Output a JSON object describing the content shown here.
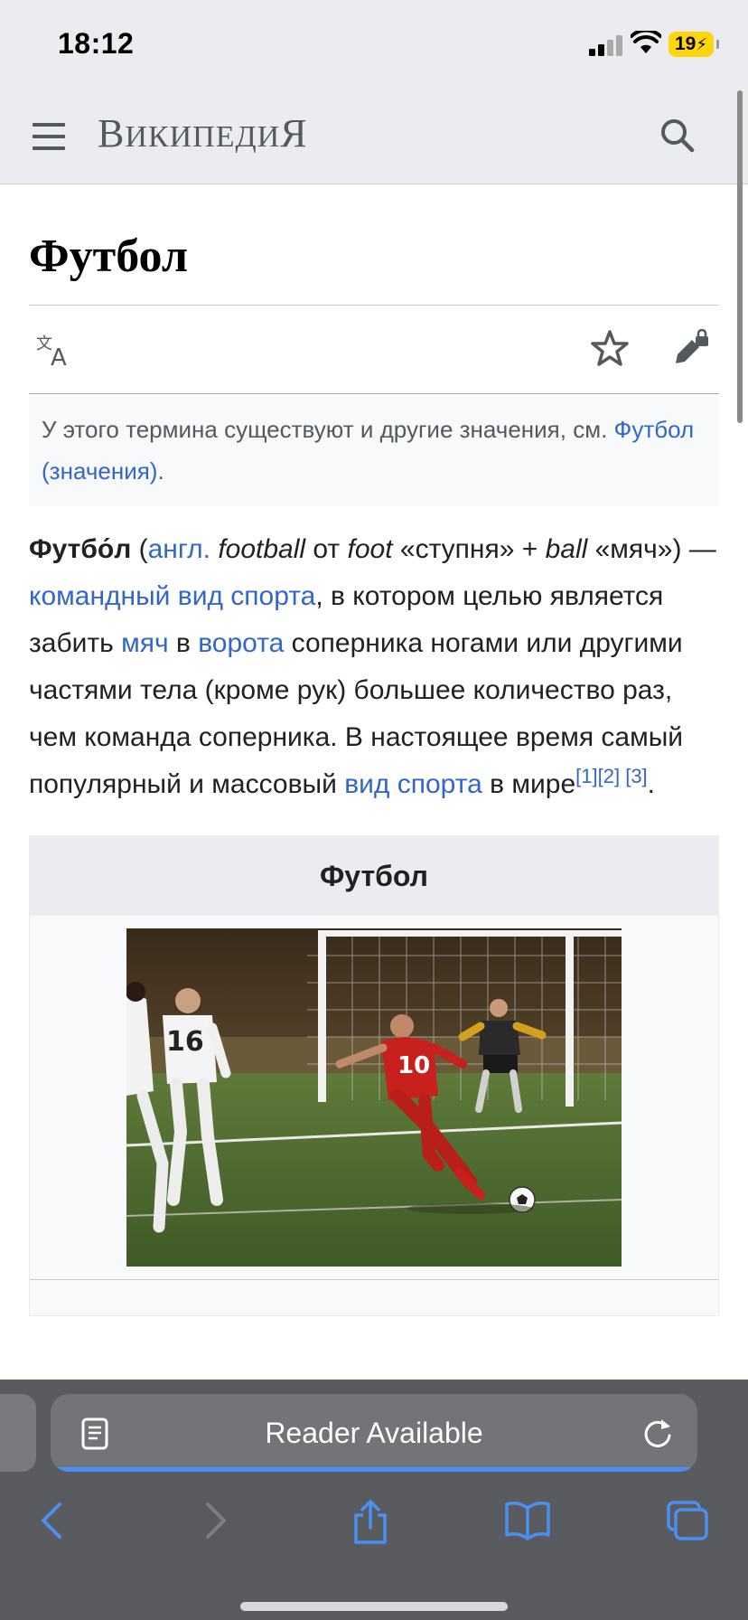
{
  "status": {
    "time": "18:12",
    "battery": "19"
  },
  "header": {
    "wordmark_first": "В",
    "wordmark_small": "ИКИПЕДИ",
    "wordmark_last": "Я"
  },
  "article": {
    "title": "Футбол",
    "hatnote_text": "У этого термина существуют и другие значения, см.",
    "hatnote_link": "Футбол (значения)",
    "hatnote_end": ".",
    "lead": {
      "term": "Футбо́л",
      "p1": " (",
      "engl": "англ.",
      "football": "football",
      "from": " от ",
      "foot": "foot",
      "foot_tr": " «ступня» + ",
      "ball": "ball",
      "ball_tr": " «мяч») — ",
      "link_team_sport": "командный вид спорта",
      "t2": ", в котором целью является забить ",
      "link_ball": "мяч",
      "t3": " в ",
      "link_goal": "ворота",
      "t4": " соперника ногами или другими частями тела (кроме рук) большее количество раз, чем команда соперника. В настоящее время самый популярный и массовый ",
      "link_sport": "вид спорта",
      "t5": " в мире",
      "ref1": "[1]",
      "ref2": "[2]",
      "ref3": "[3]",
      "end": "."
    },
    "infobox": {
      "title": "Футбол"
    }
  },
  "safari": {
    "url_label": "Reader Available"
  },
  "colors": {
    "link": "#3366cc",
    "header_bg": "#eaecf0",
    "toolbar_accent": "#4a90f0"
  },
  "icons": [
    "hamburger-icon",
    "search-icon",
    "language-icon",
    "star-icon",
    "edit-lock-icon",
    "reader-icon",
    "reload-icon",
    "back-icon",
    "forward-icon",
    "share-icon",
    "bookmarks-icon",
    "tabs-icon"
  ]
}
